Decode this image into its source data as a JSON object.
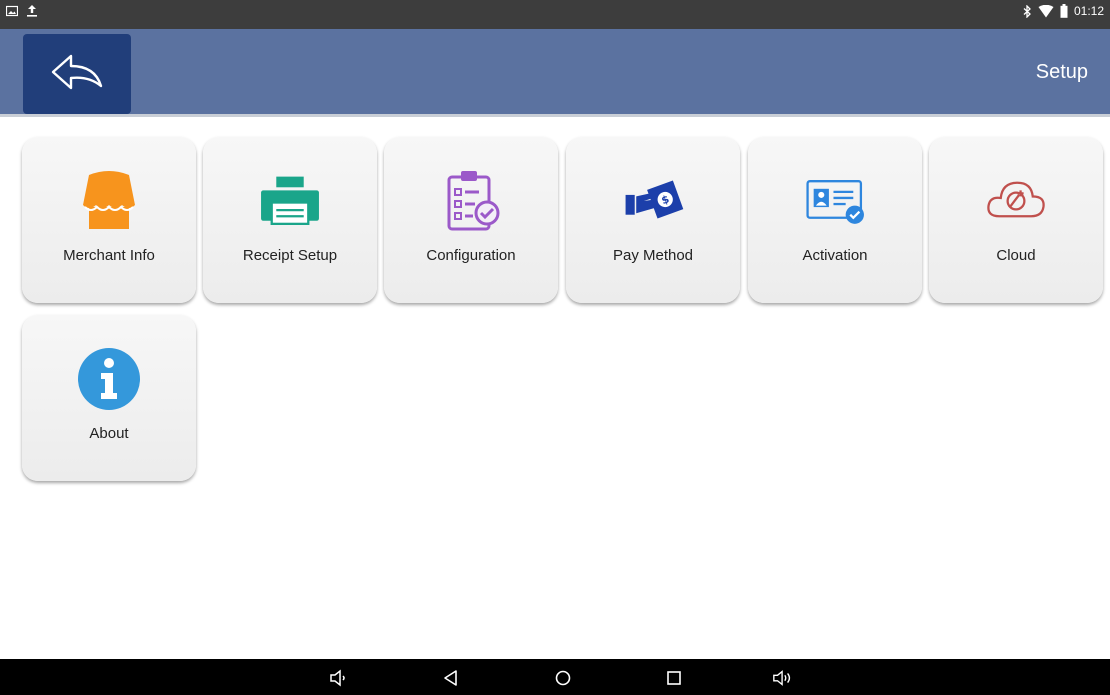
{
  "status_bar": {
    "time": "01:12",
    "left_icons": [
      "image-icon",
      "upload-icon"
    ],
    "right_icons": [
      "bluetooth-icon",
      "wifi-icon",
      "battery-icon"
    ]
  },
  "header": {
    "title": "Setup",
    "back_icon": "back-arrow-icon",
    "background_color": "#5b72a0",
    "back_button_color": "#213e7a"
  },
  "tiles": [
    {
      "label": "Merchant Info",
      "icon": "store-awning-icon",
      "color": "#f7941d"
    },
    {
      "label": "Receipt Setup",
      "icon": "printer-icon",
      "color": "#1aa58a"
    },
    {
      "label": "Configuration",
      "icon": "clipboard-checklist-icon",
      "color": "#9b59c9"
    },
    {
      "label": "Pay Method",
      "icon": "hand-money-icon",
      "color": "#1c3faa"
    },
    {
      "label": "Activation",
      "icon": "id-card-check-icon",
      "color": "#2e86de"
    },
    {
      "label": "Cloud",
      "icon": "cloud-wrench-icon",
      "color": "#c0504d"
    },
    {
      "label": "About",
      "icon": "info-icon",
      "color": "#3498db"
    }
  ],
  "nav_bar": {
    "buttons": [
      "volume-down-icon",
      "back-triangle-icon",
      "home-circle-icon",
      "recents-square-icon",
      "volume-up-icon"
    ]
  }
}
